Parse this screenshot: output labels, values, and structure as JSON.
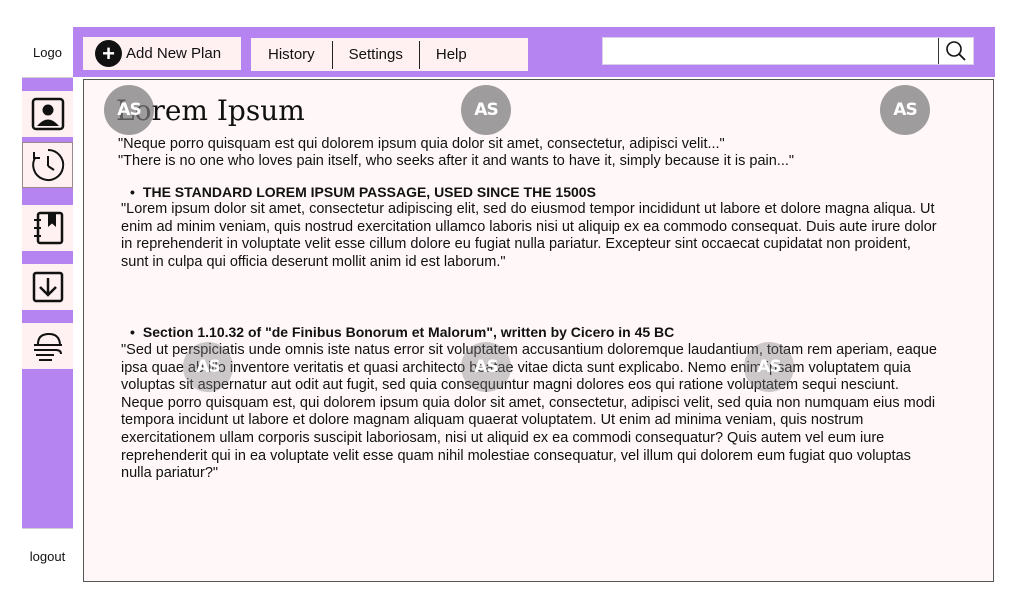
{
  "sidebar": {
    "logo": "Logo",
    "logout": "logout",
    "items": [
      {
        "icon": "user-profile-icon"
      },
      {
        "icon": "clock-history-icon"
      },
      {
        "icon": "notebook-bookmark-icon"
      },
      {
        "icon": "download-icon"
      },
      {
        "icon": "weather-wind-icon"
      }
    ]
  },
  "toolbar": {
    "add_plan_label": "Add New Plan",
    "menu": [
      "History",
      "Settings",
      "Help"
    ],
    "search_placeholder": "",
    "search_value": ""
  },
  "content": {
    "title": "Lorem Ipsum",
    "quote1": "\"Neque porro quisquam est qui dolorem ipsum quia dolor sit amet, consectetur, adipisci velit...\"",
    "quote2": "\"There is no one who loves pain itself, who seeks after it and wants to have it, simply because it is pain...\"",
    "section1_heading": "THE STANDARD LOREM IPSUM PASSAGE, USED SINCE THE 1500S",
    "section1_text": "\"Lorem ipsum dolor sit amet, consectetur adipiscing elit, sed do eiusmod tempor incididunt ut labore et dolore magna aliqua. Ut enim ad minim veniam, quis nostrud exercitation ullamco laboris nisi ut aliquip ex ea commodo consequat. Duis aute irure dolor in reprehenderit in voluptate velit esse cillum dolore eu fugiat nulla pariatur. Excepteur sint occaecat cupidatat non proident, sunt in culpa qui officia deserunt mollit anim id est laborum.\"",
    "section2_heading": "Section 1.10.32 of \"de Finibus Bonorum et Malorum\", written by Cicero in 45 BC",
    "section2_text": "\"Sed ut perspiciatis unde omnis iste natus error sit voluptatem accusantium doloremque laudantium, totam rem aperiam, eaque ipsa quae ab illo inventore veritatis et quasi architecto beatae vitae dicta sunt explicabo. Nemo enim ipsam voluptatem quia voluptas sit aspernatur aut odit aut fugit, sed quia consequuntur magni dolores eos qui ratione voluptatem sequi nesciunt. Neque porro quisquam est, qui dolorem ipsum quia dolor sit amet, consectetur, adipisci velit, sed quia non numquam eius modi tempora incidunt ut labore et dolore magnam aliquam quaerat voluptatem. Ut enim ad minima veniam, quis nostrum exercitationem ullam corporis suscipit laboriosam, nisi ut aliquid ex ea commodi consequatur? Quis autem vel eum iure reprehenderit qui in ea voluptate velit esse quam nihil molestiae consequatur, vel illum qui dolorem eum fugiat quo voluptas nulla pariatur?\""
  },
  "watermark_text": "AS",
  "colors": {
    "accent": "#b584f0",
    "panel": "#fff0f1",
    "content_bg": "#fff7f8"
  }
}
